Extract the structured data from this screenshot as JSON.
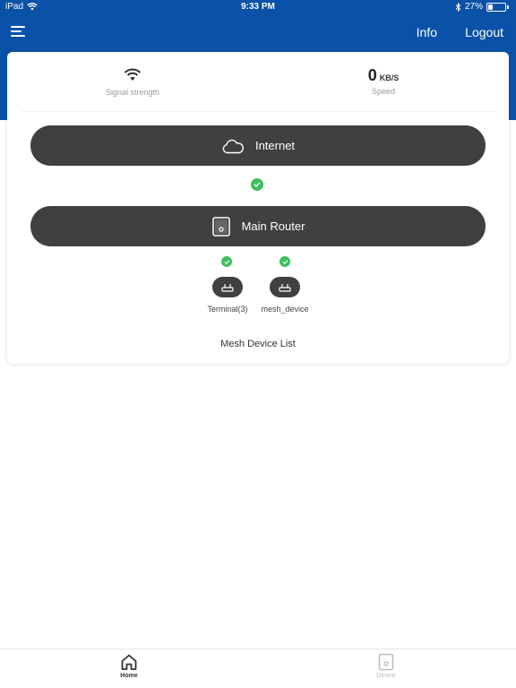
{
  "status_bar": {
    "device": "iPad",
    "time": "9:33 PM",
    "battery_percent": "27%",
    "battery_level": 0.27
  },
  "nav": {
    "info_label": "Info",
    "logout_label": "Logout"
  },
  "stats": {
    "signal_label": "Signal strength",
    "speed_value": "0",
    "speed_unit": "KB/S",
    "speed_label": "Speed"
  },
  "topology": {
    "internet_label": "Internet",
    "router_label": "Main Router",
    "terminal_label": "Terminal(3)",
    "mesh_label": "mesh_device",
    "mesh_list_label": "Mesh Device List"
  },
  "tabs": [
    {
      "label": "Home",
      "active": true
    },
    {
      "label": "Device",
      "active": false
    }
  ],
  "colors": {
    "brand_blue": "#0a51a8",
    "pill_dark": "#404040",
    "status_green": "#3fbf5f"
  }
}
